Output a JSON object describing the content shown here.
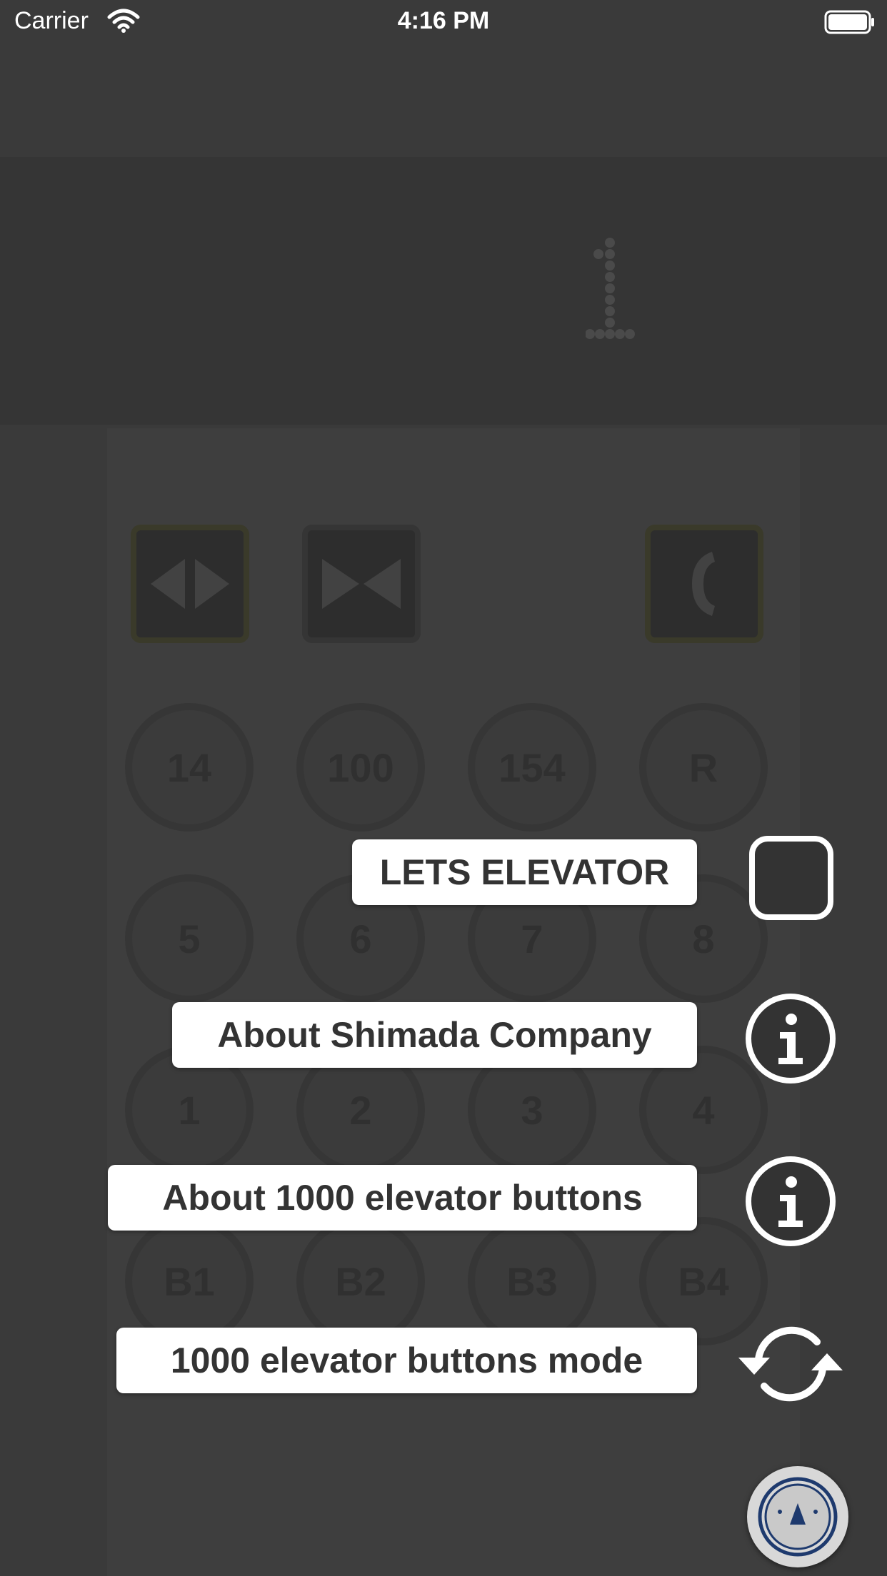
{
  "status_bar": {
    "carrier": "Carrier",
    "time": "4:16 PM"
  },
  "display": {
    "current_floor": "1"
  },
  "control_buttons": [
    {
      "name": "door-open",
      "icon": "door-open-icon"
    },
    {
      "name": "door-close",
      "icon": "door-close-icon"
    },
    {
      "name": "emergency-call",
      "icon": "phone-icon"
    }
  ],
  "floor_buttons": [
    [
      "14",
      "100",
      "154",
      "R"
    ],
    [
      "5",
      "6",
      "7",
      "8"
    ],
    [
      "1",
      "2",
      "3",
      "4"
    ],
    [
      "B1",
      "B2",
      "B3",
      "B4"
    ]
  ],
  "menu": {
    "items": [
      {
        "label": "LETS ELEVATOR",
        "icon": "square-icon"
      },
      {
        "label": "About Shimada Company",
        "icon": "info-icon"
      },
      {
        "label": "About 1000 elevator buttons",
        "icon": "info-icon"
      },
      {
        "label": "1000 elevator buttons mode",
        "icon": "refresh-icon"
      }
    ]
  },
  "fab": {
    "icon": "elevator-up-icon"
  },
  "colors": {
    "background": "#3a3a3a",
    "panel": "#353535",
    "label_background": "#ffffff",
    "label_text": "#333333",
    "fab_arrow": "#1e3a6e"
  }
}
